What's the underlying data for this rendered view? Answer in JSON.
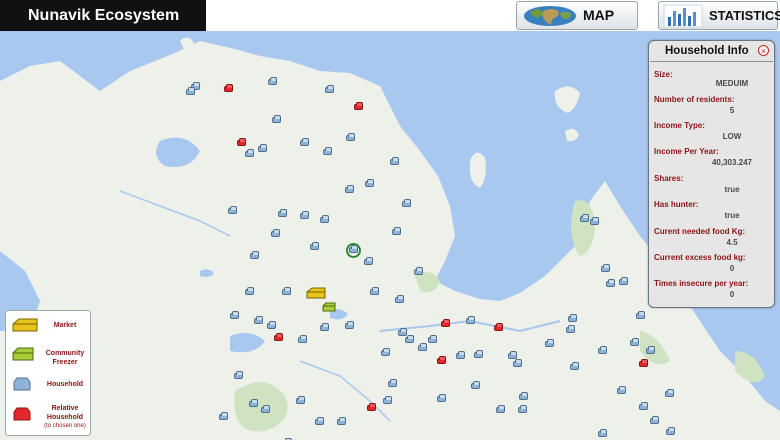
{
  "app": {
    "title": "Nunavik Ecosystem"
  },
  "tabs": [
    {
      "label": "MAP",
      "icon": "world-map-icon"
    },
    {
      "label": "STATISTICS",
      "icon": "bar-chart-icon"
    }
  ],
  "legend": {
    "market": "Market",
    "freezer_line1": "Community",
    "freezer_line2": "Freezer",
    "household": "Household",
    "relative_line1": "Relative",
    "relative_line2": "Household",
    "relative_note": "(to chosen one)"
  },
  "info_panel": {
    "title": "Household Info",
    "close_icon": "close-icon",
    "fields": [
      {
        "label": "Size:",
        "value": "MEDUIM"
      },
      {
        "label": "Number of residents:",
        "value": "5"
      },
      {
        "label": "Income Type:",
        "value": "LOW"
      },
      {
        "label": "Income Per Year:",
        "value": "40,303.247"
      },
      {
        "label": "Shares:",
        "value": "true"
      },
      {
        "label": "Has hunter:",
        "value": "true"
      },
      {
        "label": "Curent needed food Kg:",
        "value": "4.5"
      },
      {
        "label": "Current excess food kg:",
        "value": "0"
      },
      {
        "label": "Times insecure per year:",
        "value": "0"
      }
    ]
  },
  "colors": {
    "water": "#a8c8ef",
    "land": "#eef0ea",
    "household": "#8fb3d6",
    "relative": "#e3262b",
    "market": "#e6c419",
    "freezer": "#a9cc3a",
    "label_red": "#8c1414"
  }
}
